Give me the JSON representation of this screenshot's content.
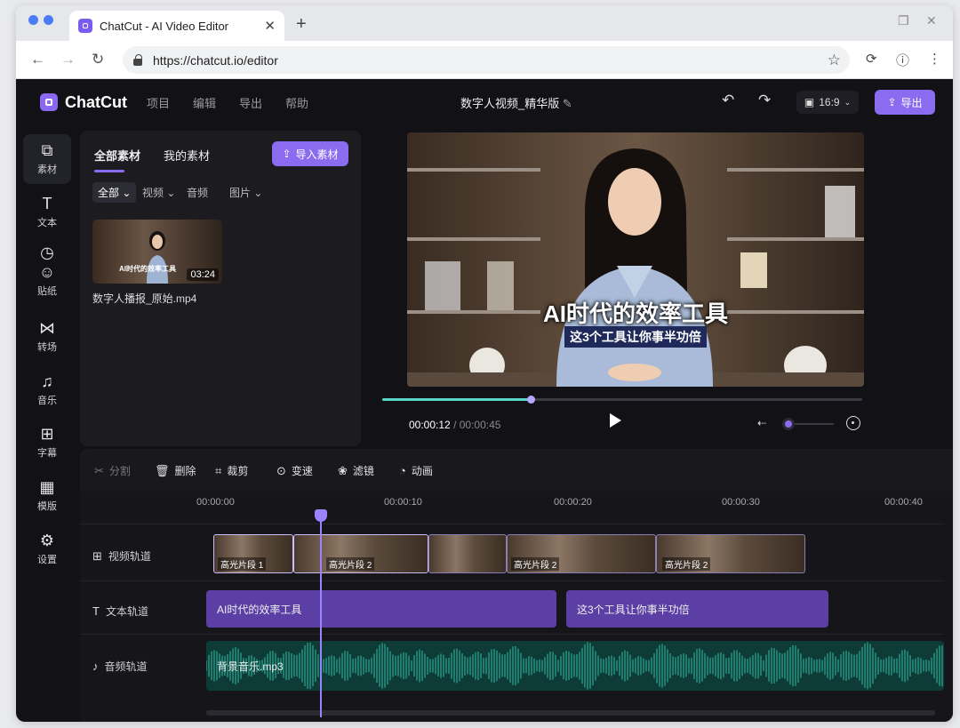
{
  "browser": {
    "tab_title": "ChatCut - AI Video Editor",
    "tab_close": "✕",
    "new_tab": "+",
    "url": "https://chatcut.io/editor"
  },
  "app": {
    "brand": "ChatCut",
    "menu": [
      "项目",
      "编辑",
      "导出",
      "帮助"
    ],
    "project_title": "数字人视频_精华版",
    "aspect_ratio": "16:9",
    "export_label": "导出"
  },
  "sidebar": {
    "items": [
      {
        "label": "素材",
        "icon": "media-icon"
      },
      {
        "label": "文本",
        "icon": "text-icon"
      },
      {
        "label": "贴纸",
        "icon": "sticker-icon"
      },
      {
        "label": "转场",
        "icon": "transition-icon"
      },
      {
        "label": "音乐",
        "icon": "music-icon"
      },
      {
        "label": "字幕",
        "icon": "subtitle-icon"
      },
      {
        "label": "模版",
        "icon": "template-icon"
      },
      {
        "label": "设置",
        "icon": "settings-icon"
      }
    ]
  },
  "media_panel": {
    "tabs": [
      "全部素材",
      "我的素材"
    ],
    "import_label": "导入素材",
    "filters": [
      "全部",
      "视频",
      "音频",
      "图片"
    ],
    "item": {
      "duration": "03:24",
      "caption": "AI时代的效率工具",
      "filename": "数字人播报_原始.mp4"
    }
  },
  "preview": {
    "title_caption": "AI时代的效率工具",
    "sub_caption": "这3个工具让你事半功倍",
    "current_time": "00:00:12",
    "total_time": "/ 00:00:45",
    "progress": 0.31
  },
  "toolbar": {
    "split": "分割",
    "delete": "删除",
    "crop": "裁剪",
    "speed": "变速",
    "filter": "滤镜",
    "animate": "动画"
  },
  "timeline": {
    "ticks": [
      "00:00:00",
      "00:00:10",
      "00:00:20",
      "00:00:30",
      "00:00:40"
    ],
    "tracks": {
      "video": "视频轨道",
      "text": "文本轨道",
      "audio": "音频轨道"
    },
    "video_clips": [
      "高光片段 1",
      "高光片段 2",
      "高光片段 2",
      "高光片段 2"
    ],
    "text_clips": [
      "AI时代的效率工具",
      "这3个工具让你事半功倍"
    ],
    "audio_clip": "背景音乐.mp3"
  },
  "colors": {
    "accent": "#8b6cf0",
    "background": "#121216",
    "audio_wave": "#1f7d6f"
  }
}
